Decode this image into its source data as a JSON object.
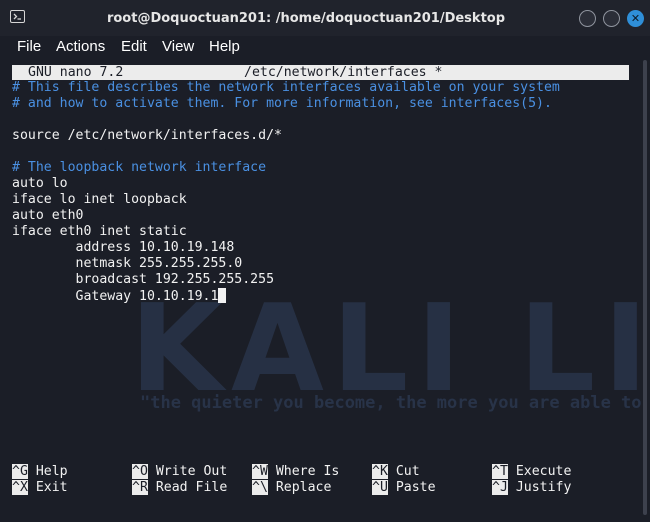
{
  "window": {
    "title": "root@Doquoctuan201: /home/doquoctuan201/Desktop",
    "minimize_glyph": "",
    "maximize_glyph": "",
    "close_glyph": "✕"
  },
  "menubar": {
    "items": [
      "File",
      "Actions",
      "Edit",
      "View",
      "Help"
    ]
  },
  "nano": {
    "version_label": "GNU nano 7.2",
    "file_path": "/etc/network/interfaces *",
    "lines": [
      "# This file describes the network interfaces available on your system",
      "# and how to activate them. For more information, see interfaces(5).",
      "",
      "source /etc/network/interfaces.d/*",
      "",
      "# The loopback network interface",
      "auto lo",
      "iface lo inet loopback",
      "auto eth0",
      "iface eth0 inet static",
      "        address 10.10.19.148",
      "        netmask 255.255.255.0",
      "        broadcast 192.255.255.255",
      "        Gateway 10.10.19.1"
    ],
    "shortcuts": [
      {
        "key": "^G",
        "label": "Help"
      },
      {
        "key": "^O",
        "label": "Write Out"
      },
      {
        "key": "^W",
        "label": "Where Is"
      },
      {
        "key": "^K",
        "label": "Cut"
      },
      {
        "key": "^T",
        "label": "Execute"
      },
      {
        "key": "^X",
        "label": "Exit"
      },
      {
        "key": "^R",
        "label": "Read File"
      },
      {
        "key": "^\\",
        "label": "Replace"
      },
      {
        "key": "^U",
        "label": "Paste"
      },
      {
        "key": "^J",
        "label": "Justify"
      }
    ]
  },
  "background": {
    "watermark": "KALI LINUX",
    "tagline": "\"the quieter you become, the more you are able to hear\""
  }
}
